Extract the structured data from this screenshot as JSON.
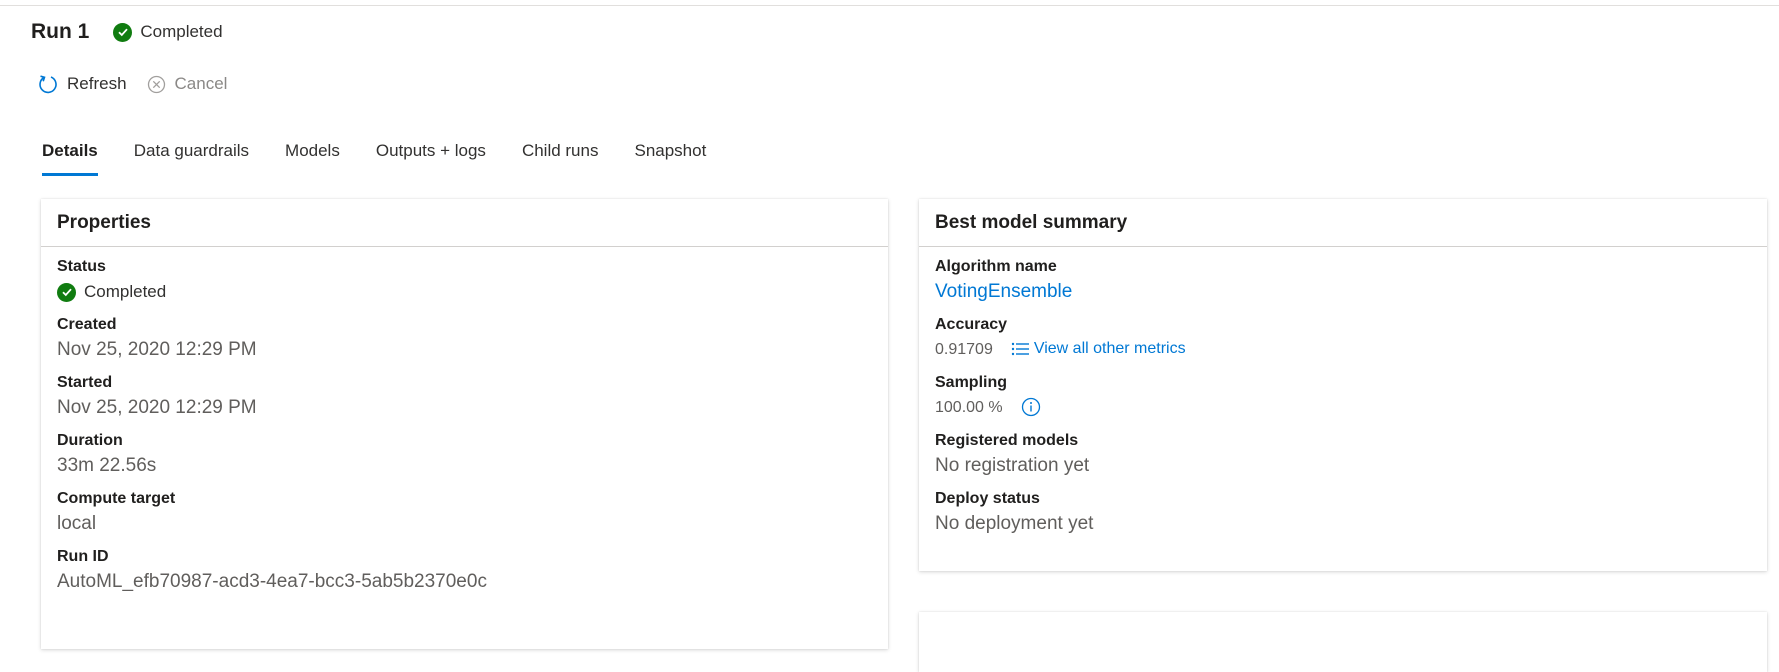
{
  "header": {
    "run_title": "Run 1",
    "status": "Completed"
  },
  "toolbar": {
    "refresh_label": "Refresh",
    "cancel_label": "Cancel"
  },
  "tabs": [
    {
      "label": "Details",
      "active": true
    },
    {
      "label": "Data guardrails",
      "active": false
    },
    {
      "label": "Models",
      "active": false
    },
    {
      "label": "Outputs + logs",
      "active": false
    },
    {
      "label": "Child runs",
      "active": false
    },
    {
      "label": "Snapshot",
      "active": false
    }
  ],
  "properties": {
    "title": "Properties",
    "status_label": "Status",
    "status_value": "Completed",
    "created_label": "Created",
    "created_value": "Nov 25, 2020 12:29 PM",
    "started_label": "Started",
    "started_value": "Nov 25, 2020 12:29 PM",
    "duration_label": "Duration",
    "duration_value": "33m 22.56s",
    "compute_label": "Compute target",
    "compute_value": "local",
    "runid_label": "Run ID",
    "runid_value": "AutoML_efb70987-acd3-4ea7-bcc3-5ab5b2370e0c"
  },
  "best_model": {
    "title": "Best model summary",
    "algorithm_label": "Algorithm name",
    "algorithm_value": "VotingEnsemble",
    "accuracy_label": "Accuracy",
    "accuracy_value": "0.91709",
    "metrics_link": "View all other metrics",
    "sampling_label": "Sampling",
    "sampling_value": "100.00 %",
    "registered_label": "Registered models",
    "registered_value": "No registration yet",
    "deploy_label": "Deploy status",
    "deploy_value": "No deployment yet"
  },
  "colors": {
    "accent": "#0078d4",
    "success": "#107c10"
  },
  "icons": {
    "status": "check-circle-icon",
    "refresh": "refresh-icon",
    "cancel": "cancel-icon",
    "metrics": "list-icon",
    "info": "info-icon"
  }
}
